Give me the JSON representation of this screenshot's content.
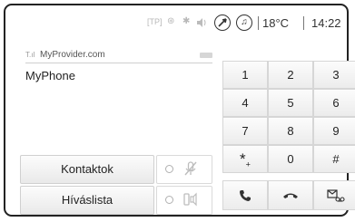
{
  "status": {
    "tp_label": "[TP]",
    "temperature": "18°C",
    "time": "14:22"
  },
  "phone": {
    "provider": "MyProvider.com",
    "device": "MyPhone"
  },
  "buttons": {
    "contacts": "Kontaktok",
    "call_list": "Híváslista"
  },
  "keypad": {
    "keys": [
      "1",
      "2",
      "3",
      "4",
      "5",
      "6",
      "7",
      "8",
      "9",
      "*",
      "0",
      "#"
    ],
    "star_sub": "+"
  },
  "icons": {
    "mute": "microphone-mute-icon",
    "handsfree": "phone-to-speaker-icon",
    "call": "phone-call-icon",
    "hangup": "hang-up-icon",
    "voicemail": "voicemail-icon"
  }
}
